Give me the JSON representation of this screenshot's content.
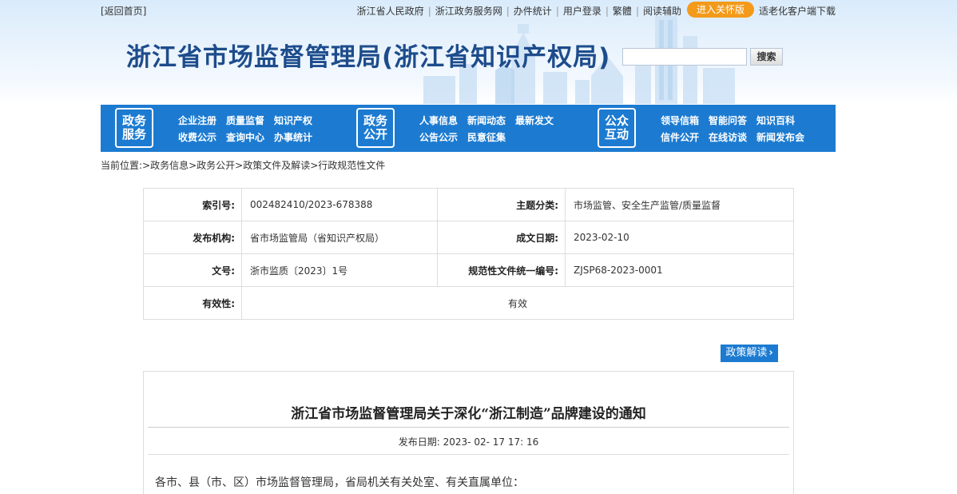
{
  "top": {
    "back_home": "[返回首页]",
    "links": [
      "浙江省人民政府",
      "浙江政务服务网",
      "办件统计",
      "用户登录",
      "繁體",
      "阅读辅助"
    ],
    "care_button": "进入关怀版",
    "elderly_client": "适老化客户端下载"
  },
  "site": {
    "title": "浙江省市场监督管理局(浙江省知识产权局)",
    "search_button": "搜索"
  },
  "nav": {
    "blocks": [
      {
        "badge": [
          "政务",
          "服务"
        ],
        "row1": [
          "企业注册",
          "质量监督",
          "知识产权"
        ],
        "row2": [
          "收费公示",
          "查询中心",
          "办事统计"
        ]
      },
      {
        "badge": [
          "政务",
          "公开"
        ],
        "row1": [
          "人事信息",
          "新闻动态",
          "最新发文"
        ],
        "row2": [
          "公告公示",
          "民意征集"
        ]
      },
      {
        "badge": [
          "公众",
          "互动"
        ],
        "row1": [
          "领导信箱",
          "智能问答",
          "知识百科"
        ],
        "row2": [
          "信件公开",
          "在线访谈",
          "新闻发布会"
        ]
      }
    ]
  },
  "breadcrumb": "当前位置:>政务信息>政务公开>政策文件及解读>行政规范性文件",
  "meta": {
    "index_label": "索引号:",
    "index_value": "002482410/2023-678388",
    "topic_label": "主题分类:",
    "topic_value": "市场监管、安全生产监管/质量监督",
    "org_label": "发布机构:",
    "org_value": "省市场监管局（省知识产权局）",
    "date_label": "成文日期:",
    "date_value": "2023-02-10",
    "docno_label": "文号:",
    "docno_value": "浙市监质〔2023〕1号",
    "code_label": "规范性文件统一编号:",
    "code_value": "ZJSP68-2023-0001",
    "valid_label": "有效性:",
    "valid_value": "有效"
  },
  "interp_button": "政策解读",
  "article": {
    "title": "浙江省市场监督管理局关于深化“浙江制造”品牌建设的通知",
    "date_line": "发布日期:  2023- 02- 17 17: 16",
    "body_first": "各市、县（市、区）市场监督管理局，省局机关有关处室、有关直属单位："
  }
}
